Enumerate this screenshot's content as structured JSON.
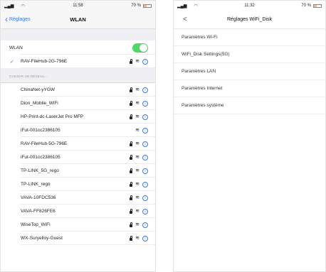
{
  "left": {
    "status": {
      "carrier_icon": "signal-bars-icon",
      "time": "11:58",
      "battery": "70 %"
    },
    "nav": {
      "back_label": "Réglages",
      "title": "WLAN"
    },
    "wlan_label": "WLAN",
    "wlan_enabled": true,
    "connected_network": "RAV-FileHub-2G-796E",
    "section_header": "CHOISIR UN RÉSEAU...",
    "networks": [
      {
        "name": "ChinaNet-yYGW",
        "locked": true
      },
      {
        "name": "Dion_Mobile_WiFi",
        "locked": true
      },
      {
        "name": "HP-Print-dc-LaserJet Pro MFP",
        "locked": true
      },
      {
        "name": "iFut-001cc2386105",
        "locked": false
      },
      {
        "name": "RAV-FileHub-5G-796E",
        "locked": true
      },
      {
        "name": "iFut-001cc2386105",
        "locked": true
      },
      {
        "name": "TP-LINK_5G_rego",
        "locked": true
      },
      {
        "name": "TP-LINK_rego",
        "locked": true
      },
      {
        "name": "VAVA-10FDC536",
        "locked": true
      },
      {
        "name": "VAVA-FF826FE6",
        "locked": true
      },
      {
        "name": "WiseTop_WiFi",
        "locked": true
      },
      {
        "name": "WX-Suryelloy-Guest",
        "locked": true
      }
    ]
  },
  "right": {
    "status": {
      "time": "11:32",
      "battery": "70 %"
    },
    "nav": {
      "back_label": "<",
      "title": "Réglages WiFi_Disk"
    },
    "menu": [
      "Paramètres Wi-Fi",
      "WiFi_Disk Settings(5G)",
      "Paramètres LAN",
      "Paramètres Internet",
      "Paramètres système"
    ]
  },
  "colors": {
    "accent": "#3478f6",
    "toggle_on": "#4cd964",
    "battery": "#f2c94c"
  }
}
